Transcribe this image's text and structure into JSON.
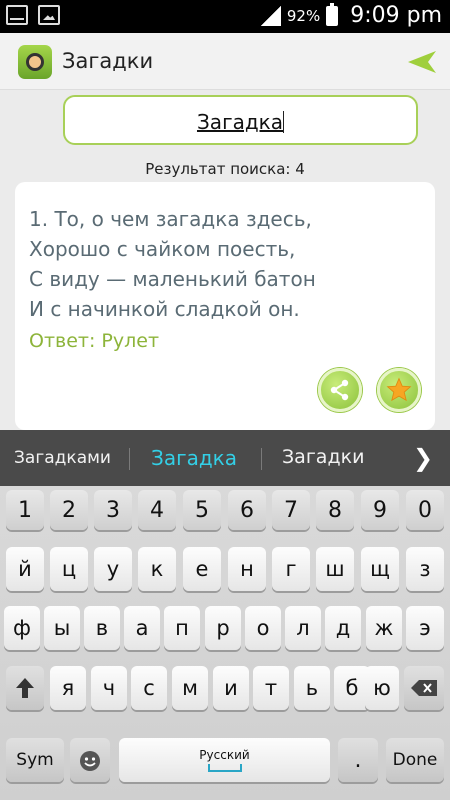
{
  "status_bar": {
    "battery_percent": "92%",
    "time": "9:09 pm"
  },
  "app_bar": {
    "title": "Загадки",
    "icons": [
      "app-logo-icon",
      "send-icon"
    ]
  },
  "search": {
    "query": "Загадка"
  },
  "results": {
    "count_label": "Результат поиска: 4"
  },
  "riddle_card": {
    "lines": [
      "1. То, о чем загадка здесь,",
      "Хорошо с чайком поесть,",
      "С виду — маленький батон",
      "И с начинкой сладкой он."
    ],
    "answer": "Ответ: Рулет",
    "buttons": [
      "share-icon",
      "star-icon"
    ]
  },
  "suggestions": {
    "items": [
      "Загадками",
      "Загадка",
      "Загадки"
    ],
    "highlighted_color": "#33cfe6"
  },
  "keyboard": {
    "number_row": [
      "1",
      "2",
      "3",
      "4",
      "5",
      "6",
      "7",
      "8",
      "9",
      "0"
    ],
    "row1": [
      "й",
      "ц",
      "у",
      "к",
      "е",
      "н",
      "г",
      "ш",
      "щ",
      "з"
    ],
    "row2": [
      "ф",
      "ы",
      "в",
      "а",
      "п",
      "р",
      "о",
      "л",
      "д",
      "ж",
      "э"
    ],
    "row3": [
      "я",
      "ч",
      "с",
      "м",
      "и",
      "т",
      "ь",
      "б",
      "ю"
    ],
    "sym_label": "Sym",
    "language": "Русский",
    "period": ".",
    "done_label": "Done"
  }
}
